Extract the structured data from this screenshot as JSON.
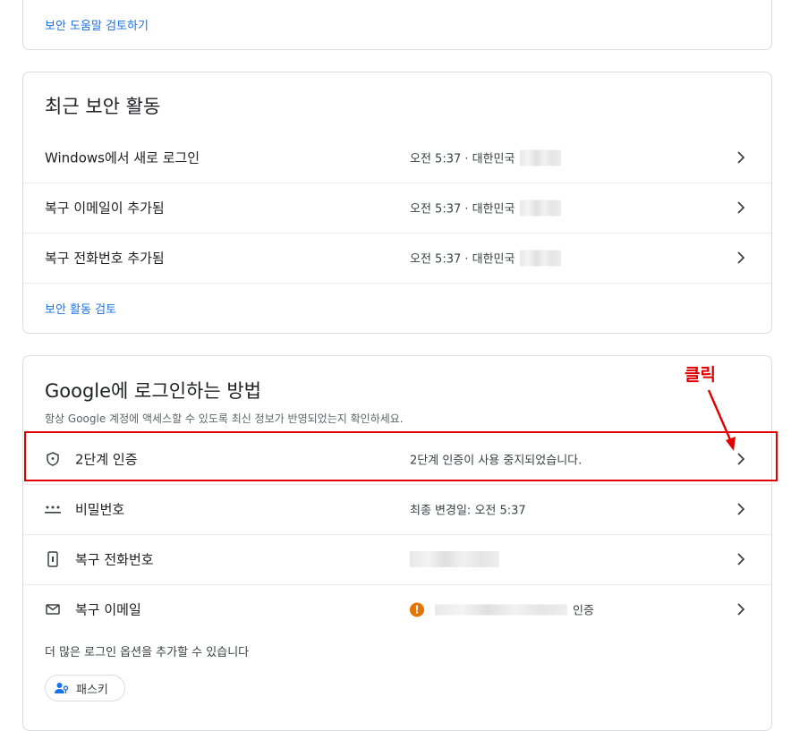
{
  "top_card": {
    "link": "보안 도움말 검토하기"
  },
  "recent_activity": {
    "title": "최근 보안 활동",
    "items": [
      {
        "label": "Windows에서 새로 로그인",
        "detail": "오전 5:37 · 대한민국"
      },
      {
        "label": "복구 이메일이 추가됨",
        "detail": "오전 5:37 · 대한민국"
      },
      {
        "label": "복구 전화번호 추가됨",
        "detail": "오전 5:37 · 대한민국"
      }
    ],
    "review_link": "보안 활동 검토"
  },
  "signin": {
    "title": "Google에 로그인하는 방법",
    "subtitle": "항상 Google 계정에 액세스할 수 있도록 최신 정보가 반영되었는지 확인하세요.",
    "items": [
      {
        "label": "2단계 인증",
        "value": "2단계 인증이 사용 중지되었습니다.",
        "icon": "shield-icon"
      },
      {
        "label": "비밀번호",
        "value": "최종 변경일: 오전 5:37",
        "icon": "password-dots-icon"
      },
      {
        "label": "복구 전화번호",
        "value": "",
        "icon": "phone-icon"
      },
      {
        "label": "복구 이메일",
        "value": "인증",
        "icon": "mail-icon"
      }
    ],
    "more_text": "더 많은 로그인 옵션을 추가할 수 있습니다",
    "passkey_label": "패스키"
  },
  "annotation": {
    "text": "클릭",
    "color": "#e00000"
  },
  "colors": {
    "link": "#1a73e8",
    "warning": "#e37400"
  }
}
